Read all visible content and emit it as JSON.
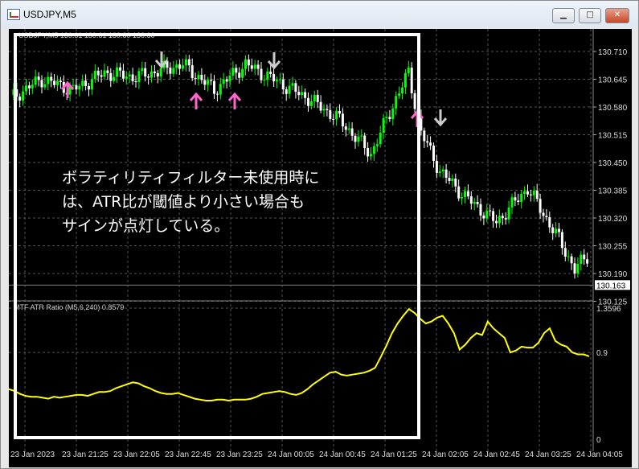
{
  "window": {
    "title": "USDJPY,M5",
    "minimize_glyph": "▁",
    "maximize_glyph": "□",
    "close_glyph": "✕"
  },
  "main_pane": {
    "header": "USDJPY,M5  130.61 130.61 130.60 130.60",
    "price_levels": [
      "130.710",
      "130.645",
      "130.580",
      "130.515",
      "130.450",
      "130.385",
      "130.320",
      "130.255",
      "130.190",
      "130.125"
    ],
    "current_price": "130.163",
    "colors": {
      "bull": "#00ff00",
      "bear": "#ffffff",
      "up_arrow": "#ff66cc",
      "down_arrow": "#cccccc",
      "current_line": "#808080"
    }
  },
  "indicator_pane": {
    "header": "MTF ATR Ratio  (M5,6,240) 0.8579",
    "levels": [
      "1.3596",
      "0.9",
      "0"
    ],
    "line_color": "#ffff00",
    "values": [
      0.52,
      0.5,
      0.47,
      0.45,
      0.44,
      0.44,
      0.43,
      0.42,
      0.44,
      0.43,
      0.44,
      0.45,
      0.46,
      0.46,
      0.45,
      0.47,
      0.49,
      0.49,
      0.5,
      0.53,
      0.55,
      0.57,
      0.59,
      0.58,
      0.55,
      0.53,
      0.5,
      0.48,
      0.47,
      0.47,
      0.48,
      0.46,
      0.44,
      0.42,
      0.41,
      0.4,
      0.4,
      0.41,
      0.41,
      0.4,
      0.41,
      0.41,
      0.41,
      0.42,
      0.44,
      0.47,
      0.48,
      0.49,
      0.5,
      0.49,
      0.47,
      0.46,
      0.48,
      0.52,
      0.57,
      0.61,
      0.65,
      0.69,
      0.7,
      0.67,
      0.66,
      0.67,
      0.68,
      0.69,
      0.71,
      0.74,
      0.85,
      0.97,
      1.1,
      1.2,
      1.28,
      1.35,
      1.31,
      1.25,
      1.2,
      1.22,
      1.26,
      1.28,
      1.2,
      1.1,
      0.93,
      0.98,
      1.05,
      1.1,
      1.08,
      1.22,
      1.15,
      1.1,
      1.05,
      0.9,
      0.92,
      0.96,
      0.95,
      0.95,
      1.0,
      1.1,
      1.15,
      1.02,
      0.98,
      0.96,
      0.9,
      0.88,
      0.88,
      0.86
    ]
  },
  "time_axis": [
    "23 Jan 2023",
    "23 Jan 21:25",
    "23 Jan 22:05",
    "23 Jan 22:45",
    "23 Jan 23:25",
    "24 Jan 00:05",
    "24 Jan 00:45",
    "24 Jan 01:25",
    "24 Jan 02:05",
    "24 Jan 02:45",
    "24 Jan 03:25",
    "24 Jan 04:05"
  ],
  "annotation": {
    "lines": [
      "ボラティリティフィルター未使用時に",
      "は、ATR比が閾値より小さい場合も",
      "サインが点灯している。"
    ]
  }
}
